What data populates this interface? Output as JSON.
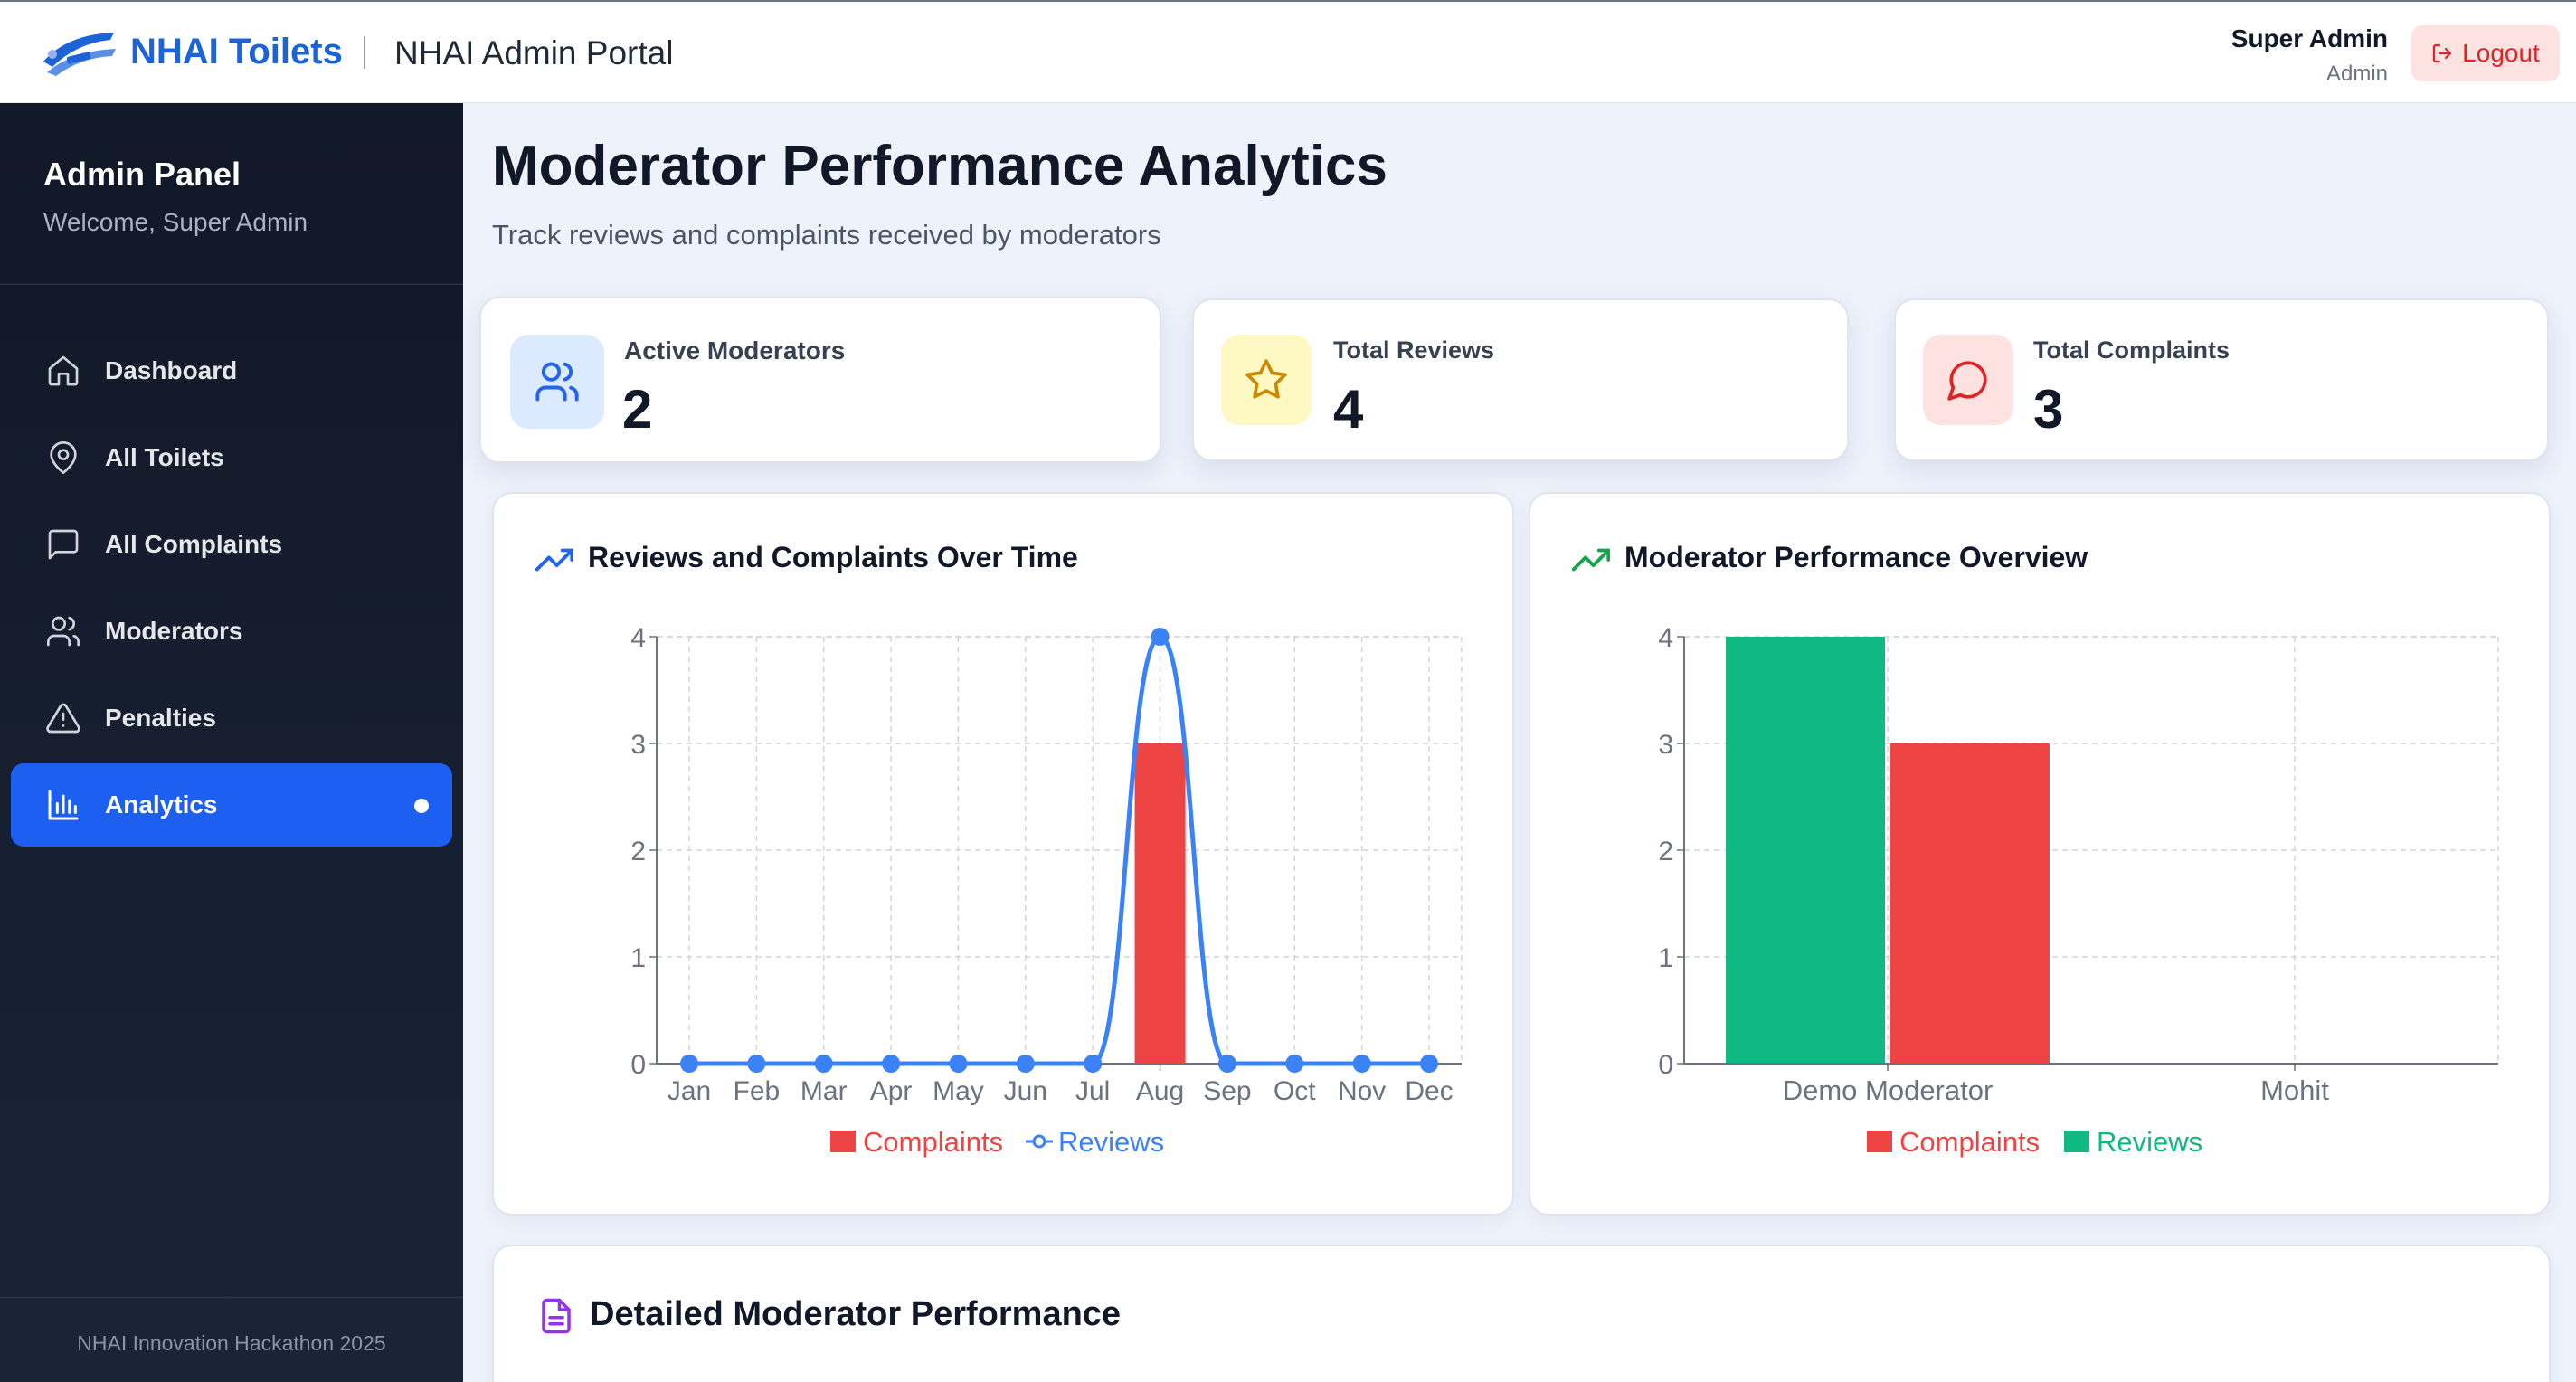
{
  "header": {
    "brand_title": "NHAI Toilets",
    "brand_subtitle": "NHAI Admin Portal",
    "user_name": "Super Admin",
    "user_role": "Admin",
    "logout_label": "Logout"
  },
  "sidebar": {
    "title": "Admin Panel",
    "welcome": "Welcome, Super Admin",
    "items": [
      {
        "label": "Dashboard",
        "icon": "home-icon",
        "active": false
      },
      {
        "label": "All Toilets",
        "icon": "map-pin-icon",
        "active": false
      },
      {
        "label": "All Complaints",
        "icon": "message-square-icon",
        "active": false
      },
      {
        "label": "Moderators",
        "icon": "users-icon",
        "active": false
      },
      {
        "label": "Penalties",
        "icon": "alert-triangle-icon",
        "active": false
      },
      {
        "label": "Analytics",
        "icon": "bar-chart-icon",
        "active": true
      }
    ],
    "footer": "NHAI Innovation Hackathon 2025"
  },
  "page": {
    "title": "Moderator Performance Analytics",
    "subtitle": "Track reviews and complaints received by moderators"
  },
  "stats": [
    {
      "label": "Active Moderators",
      "value": "2",
      "icon": "users-icon",
      "color": "#2563eb",
      "bg": "#dbeafe"
    },
    {
      "label": "Total Reviews",
      "value": "4",
      "icon": "star-icon",
      "color": "#ca8a04",
      "bg": "#fef9c3"
    },
    {
      "label": "Total Complaints",
      "value": "3",
      "icon": "message-circle-icon",
      "color": "#dc2626",
      "bg": "#fee2e2"
    }
  ],
  "panels": {
    "over_time_title": "Reviews and Complaints Over Time",
    "overview_title": "Moderator Performance Overview",
    "detailed_title": "Detailed Moderator Performance"
  },
  "colors": {
    "accent": "#1d5ff0",
    "complaints": "#ef4444",
    "reviews_line": "#3b82f6",
    "reviews_bar": "#10b981"
  },
  "chart_data": [
    {
      "type": "bar",
      "title": "Reviews and Complaints Over Time",
      "categories": [
        "Jan",
        "Feb",
        "Mar",
        "Apr",
        "May",
        "Jun",
        "Jul",
        "Aug",
        "Sep",
        "Oct",
        "Nov",
        "Dec"
      ],
      "series": [
        {
          "name": "Complaints",
          "kind": "bar",
          "values": [
            0,
            0,
            0,
            0,
            0,
            0,
            0,
            3,
            0,
            0,
            0,
            0
          ]
        },
        {
          "name": "Reviews",
          "kind": "line",
          "values": [
            0,
            0,
            0,
            0,
            0,
            0,
            0,
            4,
            0,
            0,
            0,
            0
          ]
        }
      ],
      "yticks": [
        "0",
        "1",
        "2",
        "3",
        "4"
      ],
      "ylim": [
        0,
        4
      ],
      "grid": true,
      "legend": "bottom"
    },
    {
      "type": "bar",
      "title": "Moderator Performance Overview",
      "categories": [
        "Demo Moderator",
        "Mohit"
      ],
      "series": [
        {
          "name": "Reviews",
          "values": [
            4,
            0
          ]
        },
        {
          "name": "Complaints",
          "values": [
            3,
            0
          ]
        }
      ],
      "legend_order": [
        "Complaints",
        "Reviews"
      ],
      "yticks": [
        "0",
        "1",
        "2",
        "3",
        "4"
      ],
      "ylim": [
        0,
        4
      ],
      "grid": true,
      "legend": "bottom"
    }
  ]
}
